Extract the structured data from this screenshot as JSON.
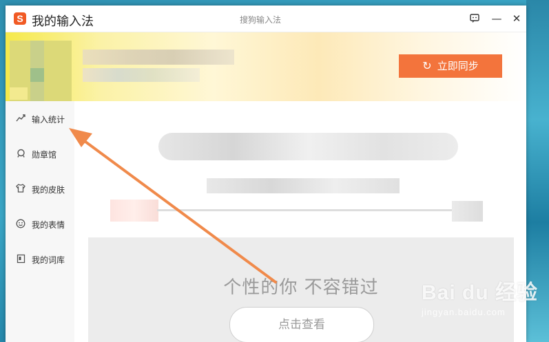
{
  "window": {
    "title": "我的输入法",
    "center_title": "搜狗输入法",
    "logo_letter": "S",
    "buttons": {
      "feedback_icon": "chat-icon",
      "minimize": "—",
      "close": "✕"
    }
  },
  "header": {
    "sync_label": "立即同步",
    "sync_icon": "↻"
  },
  "sidebar": {
    "items": [
      {
        "label": "输入统计",
        "icon": "chart-icon"
      },
      {
        "label": "勋章馆",
        "icon": "medal-icon"
      },
      {
        "label": "我的皮肤",
        "icon": "shirt-icon"
      },
      {
        "label": "我的表情",
        "icon": "smiley-icon"
      },
      {
        "label": "我的词库",
        "icon": "book-icon"
      }
    ]
  },
  "main": {
    "promo_text": "个性的你  不容错过",
    "view_button": "点击查看"
  },
  "watermark": {
    "main": "Bai du 经验",
    "sub": "jingyan.baidu.com"
  },
  "colors": {
    "accent": "#f3743c",
    "logo": "#f15a24",
    "arrow": "#f08a4b"
  }
}
